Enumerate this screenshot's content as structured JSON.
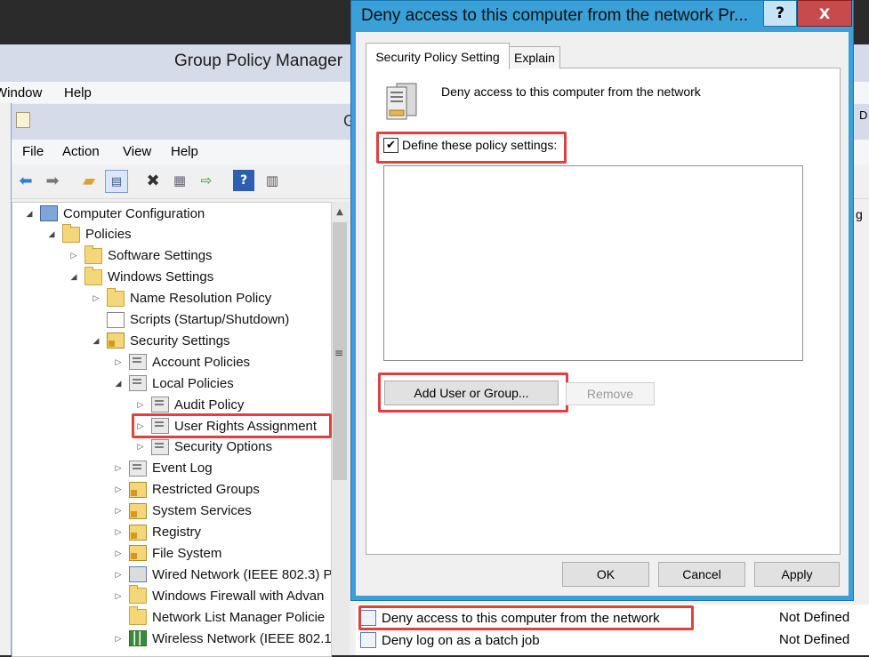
{
  "background_window": {
    "title": "Group Policy Manager",
    "menu": [
      "Window",
      "Help"
    ]
  },
  "editor": {
    "title_fragment": "G",
    "menu": [
      "File",
      "Action",
      "View",
      "Help"
    ],
    "toolbar_icons": [
      "back-arrow-icon",
      "forward-arrow-icon",
      "up-folder-icon",
      "show-hide-tree-icon",
      "delete-icon",
      "properties-icon",
      "export-list-icon",
      "help-icon",
      "show-pane-icon"
    ],
    "tree": [
      {
        "label": "Computer Configuration",
        "depth": 0,
        "expander": "open",
        "icon": "computer"
      },
      {
        "label": "Policies",
        "depth": 1,
        "expander": "open",
        "icon": "folder"
      },
      {
        "label": "Software Settings",
        "depth": 2,
        "expander": "closed",
        "icon": "folder"
      },
      {
        "label": "Windows Settings",
        "depth": 2,
        "expander": "open",
        "icon": "folder"
      },
      {
        "label": "Name Resolution Policy",
        "depth": 3,
        "expander": "closed",
        "icon": "folder"
      },
      {
        "label": "Scripts (Startup/Shutdown)",
        "depth": 3,
        "expander": "none",
        "icon": "script"
      },
      {
        "label": "Security Settings",
        "depth": 3,
        "expander": "open",
        "icon": "lock"
      },
      {
        "label": "Account Policies",
        "depth": 4,
        "expander": "closed",
        "icon": "policy"
      },
      {
        "label": "Local Policies",
        "depth": 4,
        "expander": "open",
        "icon": "policy"
      },
      {
        "label": "Audit Policy",
        "depth": 5,
        "expander": "closed",
        "icon": "policy"
      },
      {
        "label": "User Rights Assignment",
        "depth": 5,
        "expander": "closed",
        "icon": "policy"
      },
      {
        "label": "Security Options",
        "depth": 5,
        "expander": "closed",
        "icon": "policy"
      },
      {
        "label": "Event Log",
        "depth": 4,
        "expander": "closed",
        "icon": "policy"
      },
      {
        "label": "Restricted Groups",
        "depth": 4,
        "expander": "closed",
        "icon": "lock"
      },
      {
        "label": "System Services",
        "depth": 4,
        "expander": "closed",
        "icon": "lock"
      },
      {
        "label": "Registry",
        "depth": 4,
        "expander": "closed",
        "icon": "lock"
      },
      {
        "label": "File System",
        "depth": 4,
        "expander": "closed",
        "icon": "lock"
      },
      {
        "label": "Wired Network (IEEE 802.3) P",
        "depth": 4,
        "expander": "closed",
        "icon": "net"
      },
      {
        "label": "Windows Firewall with Advan",
        "depth": 4,
        "expander": "closed",
        "icon": "folder"
      },
      {
        "label": "Network List Manager Policie",
        "depth": 4,
        "expander": "none",
        "icon": "folder"
      },
      {
        "label": "Wireless Network (IEEE 802.1",
        "depth": 4,
        "expander": "closed",
        "icon": "signal"
      }
    ],
    "right_list": [
      {
        "name": "Deny access to this computer from the network",
        "value": "Not Defined"
      },
      {
        "name": "Deny log on as a batch job",
        "value": "Not Defined"
      }
    ],
    "right_frag_d": "D",
    "right_frag_g": "g"
  },
  "dialog": {
    "title": "Deny access to this computer from the network Pr...",
    "help_label": "?",
    "close_label": "X",
    "tabs": [
      "Security Policy Setting",
      "Explain"
    ],
    "policy_heading": "Deny access to this computer from the network",
    "define_checked": "✔",
    "define_label": "Define these policy settings:",
    "add_button": "Add User or Group...",
    "remove_button": "Remove",
    "ok_button": "OK",
    "cancel_button": "Cancel",
    "apply_button": "Apply"
  },
  "colors": {
    "highlight": "#e2403f",
    "dialog_frame": "#3aa0d8",
    "close_button": "#c74b4b"
  }
}
